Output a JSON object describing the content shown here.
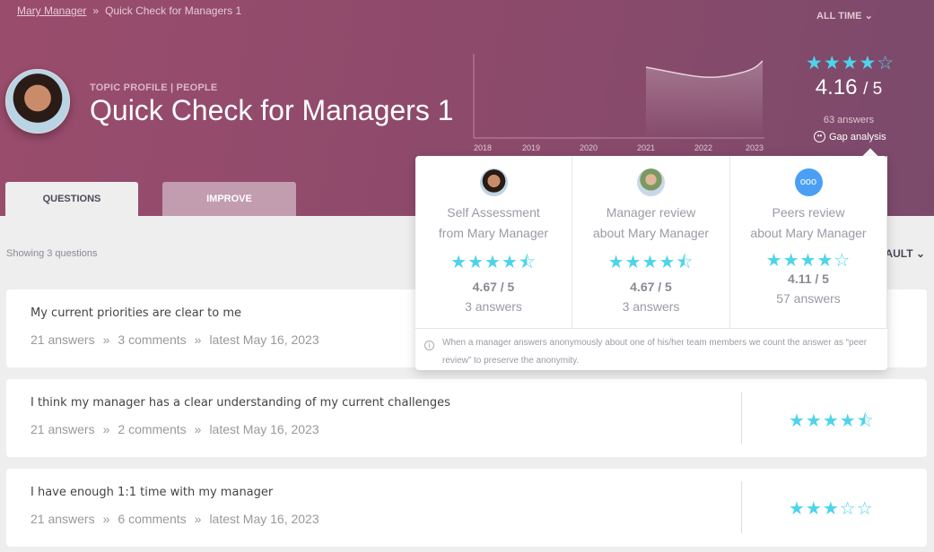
{
  "breadcrumb": {
    "parent": "Mary Manager",
    "separator": "»",
    "current": "Quick Check for Managers 1"
  },
  "header": {
    "subtitle": "TOPIC PROFILE | PEOPLE",
    "title": "Quick Check for Managers 1",
    "period": "ALL TIME",
    "period_icon": "chevron-down-icon"
  },
  "trend": {
    "x_ticks": [
      "2018",
      "2019",
      "2020",
      "2021",
      "2022",
      "2023"
    ]
  },
  "summary": {
    "stars": "★★★★☆",
    "rating": 4.16,
    "score": "4.16",
    "out_of": "/ 5",
    "answers": "63 answers",
    "gap_label": "Gap analysis"
  },
  "tabs": [
    {
      "label": "QUESTIONS",
      "active": true
    },
    {
      "label": "IMPROVE",
      "active": false
    }
  ],
  "list": {
    "showing": "Showing 3 questions",
    "sort": "DEFAULT"
  },
  "gap": {
    "columns": [
      {
        "line1": "Self Assessment",
        "line2": "from Mary Manager",
        "stars": "★★★★⯪",
        "score": "4.67 / 5",
        "answers": "3 answers"
      },
      {
        "line1": "Manager review",
        "line2": "about Mary Manager",
        "stars": "★★★★⯪",
        "score": "4.67 / 5",
        "answers": "3 answers"
      },
      {
        "line1": "Peers review",
        "line2": "about Mary Manager",
        "stars": "★★★★☆",
        "score": "4.11 / 5",
        "answers": "57 answers"
      }
    ],
    "note": "When a manager answers anonymously about one of his/her team members we count the answer as “peer review” to preserve the anonymity."
  },
  "questions": [
    {
      "text": "My current priorities are clear to me",
      "answers": "21 answers",
      "comments": "3 comments",
      "latest": "latest May 16, 2023",
      "stars": ""
    },
    {
      "text": "I think my manager has a clear understanding of my current challenges",
      "answers": "21 answers",
      "comments": "2 comments",
      "latest": "latest May 16, 2023",
      "stars": "★★★★⯪"
    },
    {
      "text": "I have enough 1:1 time with my manager",
      "answers": "21 answers",
      "comments": "6 comments",
      "latest": "latest May 16, 2023",
      "stars": "★★★☆☆"
    }
  ],
  "colors": {
    "header": "#8c4a6b",
    "star": "#4dd4ea",
    "peer_icon": "#4a9ff5"
  }
}
